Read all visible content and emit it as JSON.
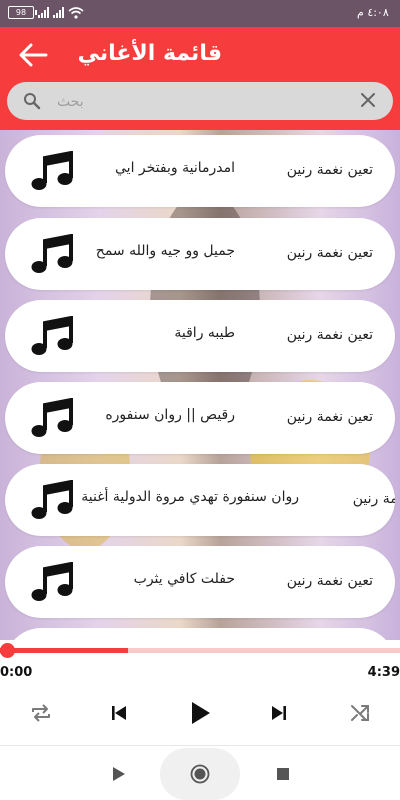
{
  "status_bar": {
    "time": "٤:٠٨ م",
    "battery": "98"
  },
  "header": {
    "title": "قائمة الأغاني"
  },
  "search": {
    "placeholder": "بحث"
  },
  "songs": [
    {
      "title": "امدرمانية وبفتخر ايي",
      "action": "تعين نغمة رنين"
    },
    {
      "title": "جميل وو جيه والله سمح",
      "action": "تعين نغمة رنين"
    },
    {
      "title": "طيبه راقية",
      "action": "تعين نغمة رنين"
    },
    {
      "title": "رقيص || روان سنفوره",
      "action": "تعين نغمة رنين"
    },
    {
      "title": "روان سنفورة تهدي مروة الدولية أغنية",
      "action": "تعين نغمة رنين"
    },
    {
      "title": "حفلت كافي يثرب",
      "action": "تعين نغمة رنين"
    }
  ],
  "player": {
    "current_time": "0:00",
    "total_time": "4:39",
    "progress": 0.0
  },
  "colors": {
    "accent": "#f63c3c",
    "status_bar": "#6a5466"
  },
  "icons": [
    "back-arrow-icon",
    "search-icon",
    "clear-icon",
    "music-note-icon",
    "repeat-icon",
    "skip-previous-icon",
    "play-icon",
    "skip-next-icon",
    "shuffle-icon",
    "record-icon",
    "stop-icon"
  ]
}
